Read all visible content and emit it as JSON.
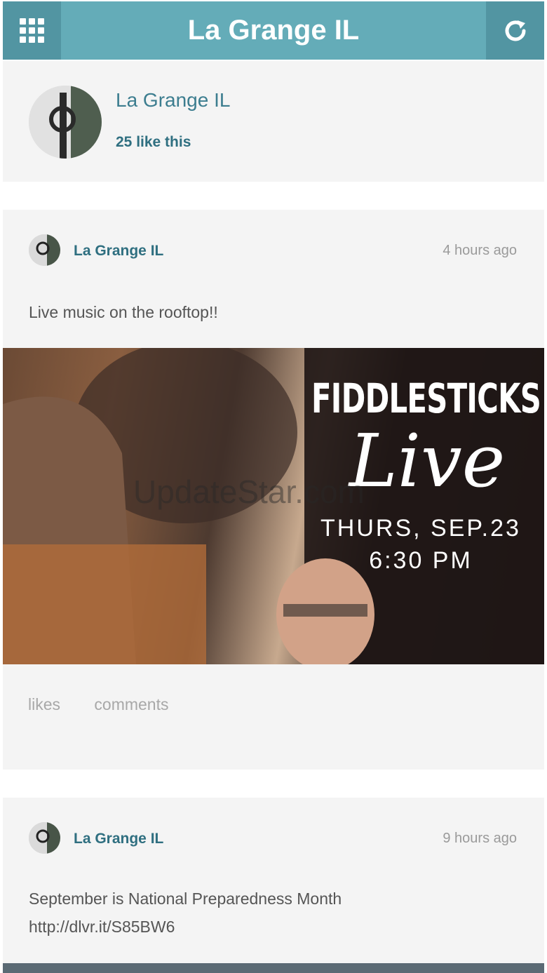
{
  "app": {
    "title": "La Grange IL"
  },
  "header": {
    "page_name": "La Grange IL",
    "likes": "25 like this"
  },
  "posts": [
    {
      "author": "La Grange IL",
      "time": "4 hours ago",
      "text": "Live music on the rooftop!!",
      "image": {
        "title": "FIDDLESTICKS",
        "script": "Live",
        "date": "THURS, SEP.23",
        "time": "6:30 PM",
        "watermark": "UpdateStar.com"
      },
      "actions": {
        "likes": "likes",
        "comments": "comments"
      }
    },
    {
      "author": "La Grange IL",
      "time": "9 hours ago",
      "text_line1": "September is National Preparedness Month",
      "text_line2": "http://dlvr.it/S85BW6"
    }
  ],
  "icons": {
    "menu": "grid-menu-icon",
    "refresh": "refresh-icon"
  },
  "colors": {
    "topbar": "#64acb8",
    "topbar_button": "#5295a2",
    "link": "#2f6f80"
  }
}
